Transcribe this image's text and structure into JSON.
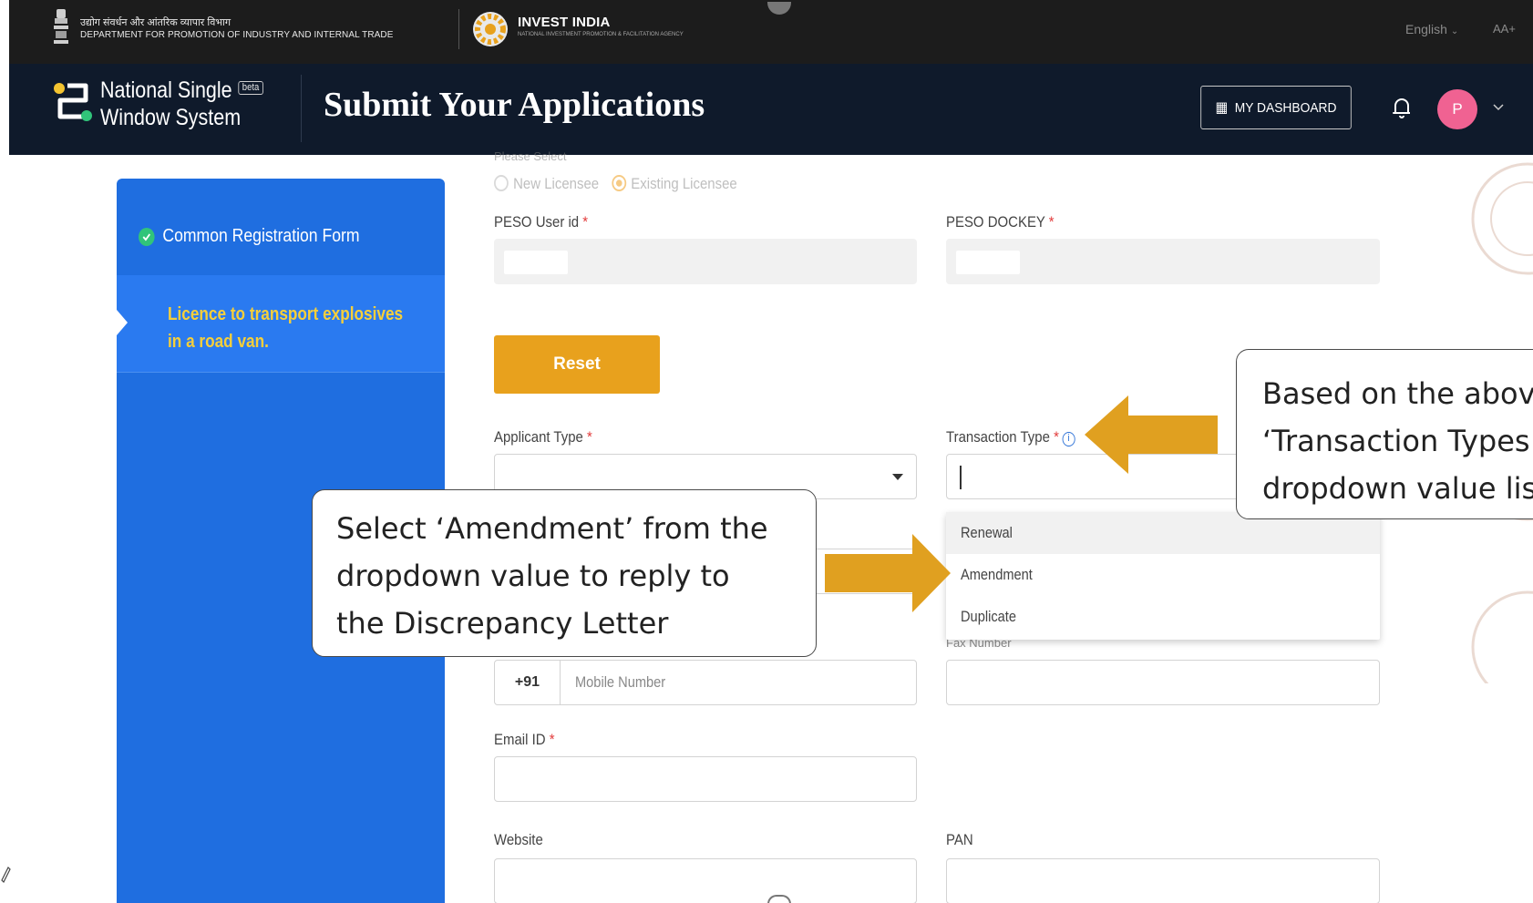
{
  "govbar": {
    "dept_hindi": "उद्योग संवर्धन और आंतरिक व्यापार विभाग",
    "dept_english": "DEPARTMENT FOR PROMOTION OF INDUSTRY AND INTERNAL TRADE",
    "invest_india": "INVEST INDIA",
    "invest_india_tagline": "NATIONAL INVESTMENT PROMOTION & FACILITATION AGENCY",
    "language": "English",
    "font_size_control": "AA+"
  },
  "header": {
    "app_name_line1": "National Single",
    "app_name_line2": "Window System",
    "beta_badge": "beta",
    "page_title": "Submit Your Applications",
    "dashboard_button": "MY DASHBOARD",
    "avatar_initial": "P"
  },
  "sidebar": {
    "items": [
      {
        "label": "Common Registration Form",
        "status": "completed"
      },
      {
        "label": "Licence to transport explosives in a road van.",
        "status": "active"
      }
    ]
  },
  "form": {
    "please_select": "Please Select",
    "licensee_options": [
      "New Licensee",
      "Existing Licensee"
    ],
    "licensee_selected": "Existing Licensee",
    "peso_user_id_label": "PESO User id",
    "peso_dockey_label": "PESO DOCKEY",
    "reset_button": "Reset",
    "applicant_type_label": "Applicant Type",
    "transaction_type_label": "Transaction Type",
    "transaction_type_options": [
      "Renewal",
      "Amendment",
      "Duplicate"
    ],
    "fax_label_partial": "Fax Number",
    "mobile_prefix": "+91",
    "mobile_placeholder": "Mobile Number",
    "email_label": "Email ID",
    "website_label": "Website",
    "pan_label": "PAN",
    "required_marker": "*"
  },
  "callouts": {
    "select_amendment": [
      "Select ‘Amendment’ from the",
      "dropdown value to reply to",
      "the Discrepancy Letter"
    ],
    "transaction_types": [
      "Based on the abov",
      "‘Transaction Types",
      "dropdown value lis"
    ]
  },
  "colors": {
    "topbar": "#1c1c1c",
    "header": "#0f1a2b",
    "sidebar": "#1f6ee0",
    "accent_orange": "#e8a11d",
    "arrow": "#e0a020",
    "active_label": "#f6cf3a"
  }
}
